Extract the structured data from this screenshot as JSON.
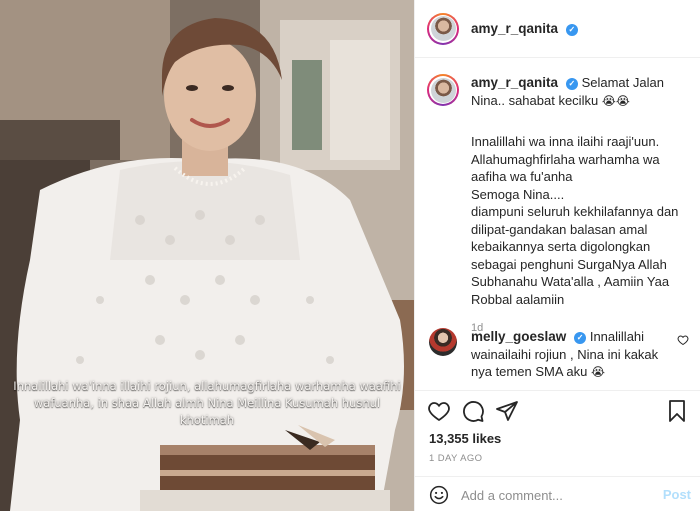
{
  "photo": {
    "caption": "Innalillahi wa'inna illaihi rojiun, allahumagfirlaha warhamha waafihi wafuanha, in shaa Allah almh Nina Meillina Kusumah husnul khotimah"
  },
  "header": {
    "username": "amy_r_qanita",
    "verified_icon": "verified-badge-icon",
    "avatar_icon": "profile-avatar"
  },
  "post": {
    "username": "amy_r_qanita",
    "first_line": "Selamat Jalan Nina.. sahabat kecilku",
    "first_line_emoji": "😭😭",
    "body": "Innalillahi wa inna ilaihi raaji'uun.\nAllahumaghfirlaha warhamha wa aafiha wa fu'anha\nSemoga Nina....\ndiampuni seluruh kekhilafannya dan dilipat-gandakan balasan amal kebaikannya serta digolongkan sebagai penghuni SurgaNya Allah Subhanahu Wata'alla , Aamiin Yaa Robbal aalamiin",
    "time": "1d"
  },
  "reply": {
    "username": "melly_goeslaw",
    "text": "Innalillahi wainailaihi rojiun , Nina ini kakak nya temen SMA aku",
    "emoji": "😭"
  },
  "actions": {
    "icons": [
      "heart-icon",
      "comment-icon",
      "share-icon",
      "save-icon"
    ],
    "likes": "13,355 likes",
    "date": "1 DAY AGO"
  },
  "add_comment": {
    "placeholder": "Add a comment...",
    "post_label": "Post",
    "emoji_icon": "emoji-icon"
  },
  "colors": {
    "verified": "#3897f0",
    "post_button_disabled": "#b2dffc",
    "secondary_text": "#8e8e8e",
    "border": "#efefef"
  }
}
